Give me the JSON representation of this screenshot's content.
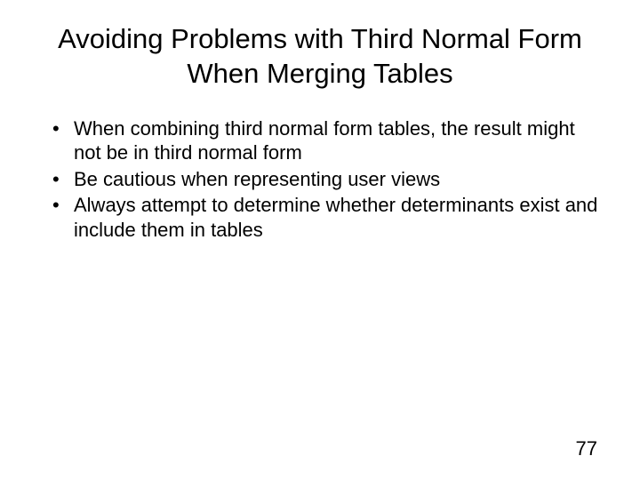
{
  "slide": {
    "title": "Avoiding Problems with Third Normal Form When Merging Tables",
    "bullets": [
      "When combining third normal form tables, the result might not be in third normal form",
      "Be cautious when representing user views",
      "Always attempt to determine whether determinants exist and include them in tables"
    ],
    "page_number": "77"
  }
}
